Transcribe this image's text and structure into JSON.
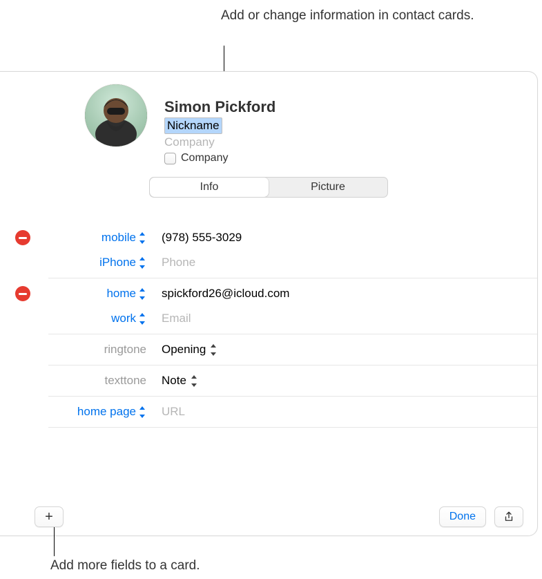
{
  "callouts": {
    "top": "Add or change information in contact cards.",
    "bottom": "Add more fields to a card."
  },
  "contact": {
    "name": "Simon Pickford",
    "nickname_placeholder": "Nickname",
    "company_placeholder": "Company",
    "company_checkbox_label": "Company"
  },
  "tabs": {
    "info": "Info",
    "picture": "Picture"
  },
  "fields": {
    "phone": [
      {
        "label": "mobile",
        "value": "(978) 555-3029",
        "hasRemove": true
      },
      {
        "label": "iPhone",
        "placeholder": "Phone",
        "hasRemove": false
      }
    ],
    "email": [
      {
        "label": "home",
        "value": "spickford26@icloud.com",
        "hasRemove": true
      },
      {
        "label": "work",
        "placeholder": "Email",
        "hasRemove": false
      }
    ],
    "ringtone": {
      "label": "ringtone",
      "value": "Opening"
    },
    "texttone": {
      "label": "texttone",
      "value": "Note"
    },
    "homepage": {
      "label": "home page",
      "placeholder": "URL"
    }
  },
  "footer": {
    "add_icon": "+",
    "done": "Done"
  }
}
